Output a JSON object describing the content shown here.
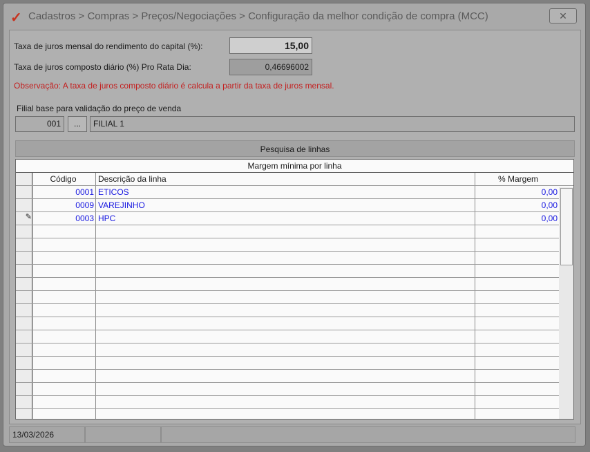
{
  "window": {
    "title": "Cadastros > Compras > Preços/Negociações > Configuração da melhor condição de compra (MCC)",
    "close_label": "✕"
  },
  "form": {
    "juros_mensal_label": "Taxa de juros mensal do rendimento do capital (%):",
    "juros_mensal_value": "15,00",
    "juros_diario_label": "Taxa de juros composto diário (%) Pro Rata Dia:",
    "juros_diario_value": "0,46696002",
    "observacao": "Observação: A taxa de juros composto diário é calcula a partir da taxa de juros mensal.",
    "filial_label": "Filial base para validação do preço de venda",
    "filial_code": "001",
    "filial_button": "...",
    "filial_name": "FILIAL 1"
  },
  "section": {
    "title": "Pesquisa de linhas"
  },
  "grid": {
    "title": "Margem mínima por linha",
    "columns": [
      "Código",
      "Descrição da linha",
      "% Margem"
    ],
    "rows": [
      {
        "codigo": "0001",
        "descricao": "ETICOS",
        "margem": "0,00"
      },
      {
        "codigo": "0009",
        "descricao": "VAREJINHO",
        "margem": "0,00"
      },
      {
        "codigo": "0003",
        "descricao": "HPC",
        "margem": "0,00"
      }
    ]
  },
  "status": {
    "date": "13/03/2026"
  }
}
